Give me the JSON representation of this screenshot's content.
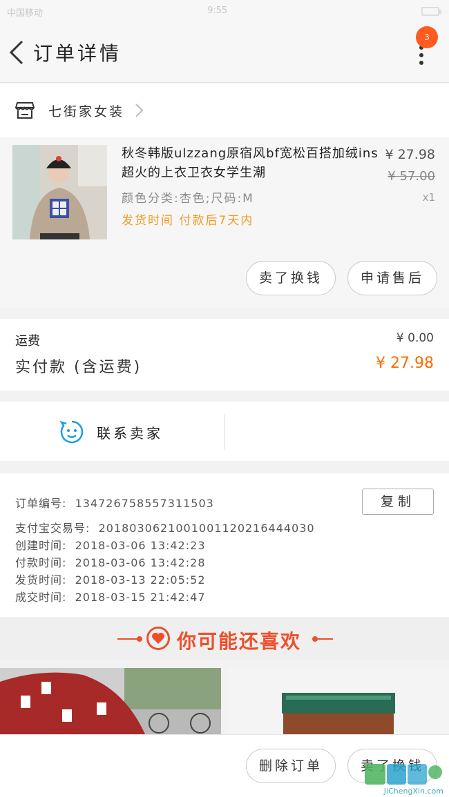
{
  "status": {
    "left": "中国移动",
    "center": "9:55"
  },
  "nav": {
    "title": "订单详情",
    "badge": "3"
  },
  "shop": {
    "name": "七街家女装"
  },
  "product": {
    "title": "秋冬韩版ulzzang原宿风bf宽松百搭加绒ins超火的上衣卫衣女学生潮",
    "sku": "颜色分类:杏色;尺码:M",
    "ship_time": "发货时间  付款后7天内",
    "price": "¥ 27.98",
    "original_price": "¥ 57.00",
    "quantity": "x1",
    "actions": [
      "卖了换钱",
      "申请售后"
    ]
  },
  "fees": {
    "freight_label": "运费",
    "freight_value": "¥ 0.00",
    "paid_label": "实付款 (含运费)",
    "paid_value": "¥ 27.98"
  },
  "contact": {
    "label": "联系卖家"
  },
  "order_info": {
    "copy_label": "复制",
    "rows": [
      {
        "label": "订单编号:",
        "value": "134726758557311503"
      },
      {
        "label": "支付宝交易号:",
        "value": "2018030621001001120216444030"
      },
      {
        "label": "创建时间:",
        "value": "2018-03-06  13:42:23"
      },
      {
        "label": "付款时间:",
        "value": "2018-03-06  13:42:28"
      },
      {
        "label": "发货时间:",
        "value": "2018-03-13  22:05:52"
      },
      {
        "label": "成交时间:",
        "value": "2018-03-15  21:42:47"
      }
    ]
  },
  "recommend": {
    "title": "你可能还喜欢"
  },
  "bottom": {
    "actions": [
      "删除订单",
      "卖了换钱"
    ]
  },
  "watermark": {
    "brand": "JiChengXin.com"
  },
  "colors": {
    "accent": "#ff6a00",
    "ship": "#f39a1e",
    "recommend": "#ee4f2b",
    "contact_icon": "#1a9fe0"
  }
}
